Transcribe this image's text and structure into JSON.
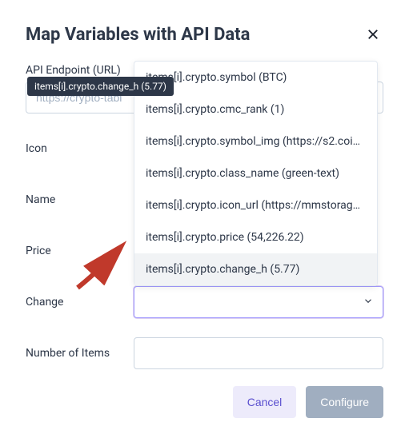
{
  "modal": {
    "title": "Map Variables with API Data"
  },
  "tooltip": {
    "text": "items[i].crypto.change_h (5.77)"
  },
  "form": {
    "endpoint_label": "API Endpoint (URL)",
    "endpoint_placeholder": "https://crypto-tabl",
    "icon_label": "Icon",
    "name_label": "Name",
    "price_label": "Price",
    "change_label": "Change",
    "items_label": "Number of Items"
  },
  "dropdown": {
    "items": [
      {
        "label": "items[i].crypto.symbol (BTC)"
      },
      {
        "label": "items[i].crypto.cmc_rank (1)"
      },
      {
        "label": "items[i].crypto.symbol_img (https://s2.coin…"
      },
      {
        "label": "items[i].crypto.class_name (green-text)"
      },
      {
        "label": "items[i].crypto.icon_url (https://mmstorage…"
      },
      {
        "label": "items[i].crypto.price (54,226.22)"
      },
      {
        "label": "items[i].crypto.change_h (5.77)"
      }
    ]
  },
  "footer": {
    "cancel": "Cancel",
    "configure": "Configure"
  }
}
